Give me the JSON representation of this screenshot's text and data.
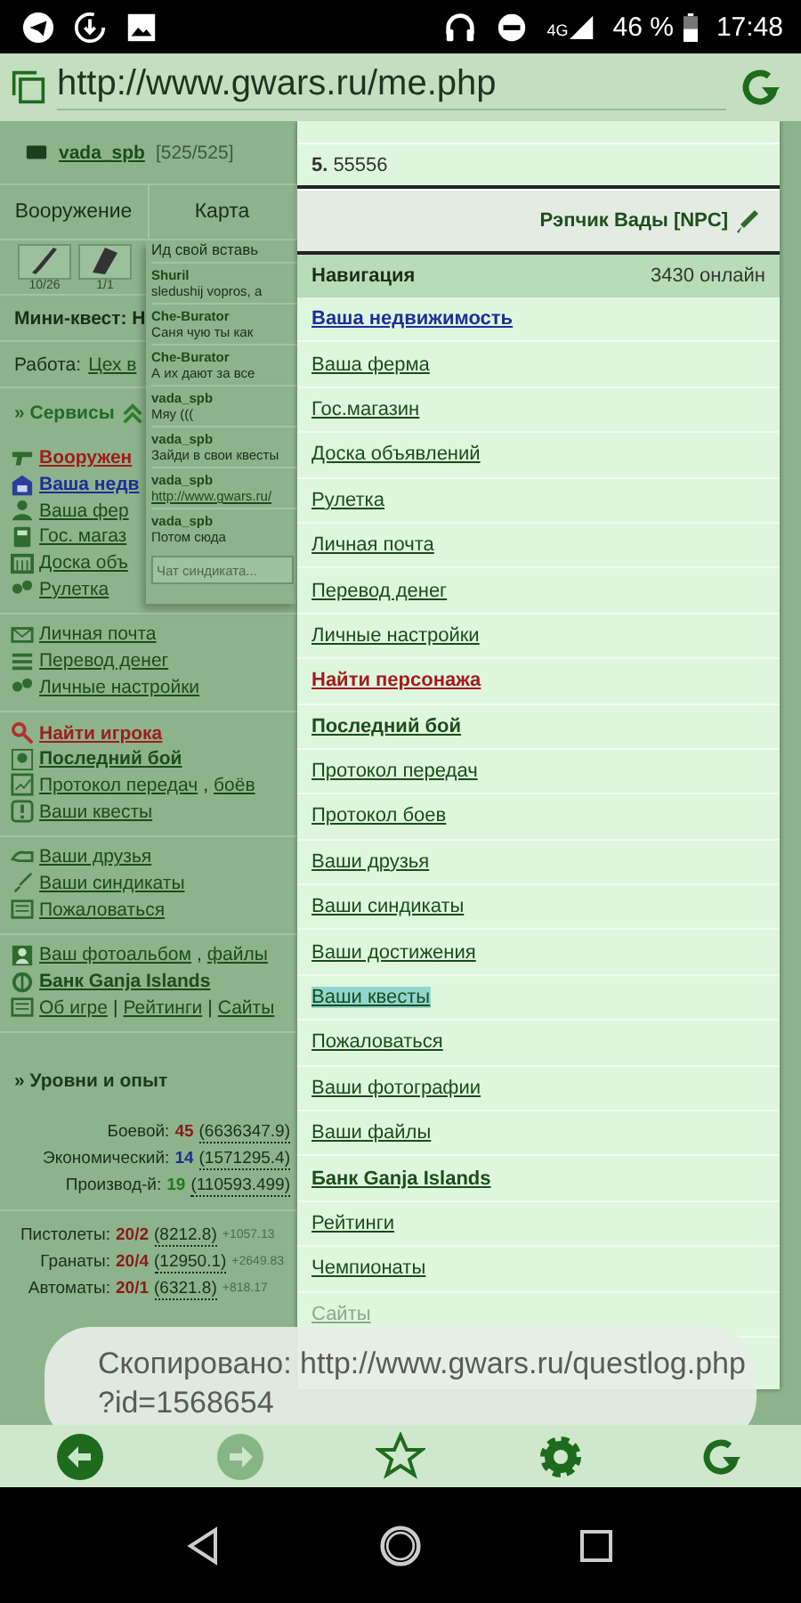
{
  "status_bar": {
    "network": "4G",
    "battery": "46 %",
    "time": "17:48"
  },
  "address_bar": {
    "url": "http://www.gwars.ru/me.php"
  },
  "player": {
    "name": "vada_spb",
    "hp": "[525/525]"
  },
  "tabs": [
    "Вооружение",
    "Карта"
  ],
  "slots": [
    {
      "count": "10/26"
    },
    {
      "count": "1/1"
    }
  ],
  "mini_quest": "Мини-квест: Н",
  "work": {
    "label": "Работа:",
    "link": "Цех в"
  },
  "services": {
    "title": "» Сервисы",
    "items": [
      {
        "links": [
          "Вооружен"
        ],
        "kind": "red"
      },
      {
        "links": [
          "Ваша недв"
        ],
        "kind": "blue"
      },
      {
        "links": [
          "Ваша фер"
        ],
        "kind": "normal"
      },
      {
        "links": [
          "Гос. магаз"
        ],
        "kind": "normal"
      },
      {
        "links": [
          "Доска объ"
        ],
        "kind": "normal"
      },
      {
        "links": [
          "Рулетка"
        ],
        "kind": "normal"
      }
    ]
  },
  "menu_groups": [
    [
      {
        "links": [
          "Личная почта"
        ],
        "kind": "normal"
      },
      {
        "links": [
          "Перевод денег"
        ],
        "kind": "normal"
      },
      {
        "links": [
          "Личные настройки"
        ],
        "kind": "normal"
      }
    ],
    [
      {
        "links": [
          "Найти игрока"
        ],
        "kind": "red"
      },
      {
        "links": [
          "Последний бой"
        ],
        "kind": "bold"
      },
      {
        "links": [
          "Протокол передач",
          "боёв"
        ],
        "separator": ",",
        "kind": "normal"
      },
      {
        "links": [
          "Ваши квесты"
        ],
        "kind": "normal"
      }
    ],
    [
      {
        "links": [
          "Ваши друзья"
        ],
        "kind": "normal"
      },
      {
        "links": [
          "Ваши синдикаты"
        ],
        "kind": "normal"
      },
      {
        "links": [
          "Пожаловаться"
        ],
        "kind": "normal"
      }
    ],
    [
      {
        "links": [
          "Ваш фотоальбом",
          "файлы"
        ],
        "separator": ",",
        "kind": "normal"
      },
      {
        "links": [
          "Банк Ganja Islands"
        ],
        "kind": "bold"
      },
      {
        "links": [
          "Об игре",
          "Рейтинги",
          "Сайты"
        ],
        "separator": "|",
        "kind": "normal"
      }
    ]
  ],
  "levels_title": "» Уровни и опыт",
  "levels": [
    {
      "label": "Боевой:",
      "value": "45",
      "exp": "(6636347.9)",
      "color": "#8b1a1a"
    },
    {
      "label": "Экономический:",
      "value": "14",
      "exp": "(1571295.4)",
      "color": "#1a2f8b"
    },
    {
      "label": "Производ-й:",
      "value": "19",
      "exp": "(110593.499)",
      "color": "#1f7a1f"
    }
  ],
  "skills": [
    {
      "label": "Пистолеты:",
      "value": "20/2",
      "exp": "(8212.8)",
      "gain": "+1057.13"
    },
    {
      "label": "Гранаты:",
      "value": "20/4",
      "exp": "(12950.1)",
      "gain": "+2649.83"
    },
    {
      "label": "Автоматы:",
      "value": "20/1",
      "exp": "(6321.8)",
      "gain": "+818.17"
    }
  ],
  "chat": {
    "top_text": "Ид свой вставь",
    "messages": [
      {
        "author": "Shuril",
        "text": "sledushij vopros, a",
        "kind": "text"
      },
      {
        "author": "Che-Burator",
        "text": "Саня чую ты как",
        "kind": "text"
      },
      {
        "author": "Che-Burator",
        "text": "А их дают за все",
        "kind": "text"
      },
      {
        "author": "vada_spb",
        "text": "Мяу (((",
        "kind": "text"
      },
      {
        "author": "vada_spb",
        "text": "Зайди в свои квесты",
        "kind": "text"
      },
      {
        "author": "vada_spb",
        "text": "http://www.gwars.ru/",
        "kind": "link"
      },
      {
        "author": "vada_spb",
        "text": "Потом сюда",
        "kind": "text"
      }
    ],
    "placeholder": "Чат синдиката..."
  },
  "nav_panel": {
    "rank": {
      "number": "5.",
      "name": "55556"
    },
    "npc": "Рэпчик Вады [NPC]",
    "title": "Навигация",
    "online": "3430 онлайн",
    "items": [
      {
        "label": "Ваша недвижимость",
        "kind": "blue",
        "selected": false
      },
      {
        "label": "Ваша ферма",
        "kind": "normal",
        "selected": false
      },
      {
        "label": "Гос.магазин",
        "kind": "normal",
        "selected": false
      },
      {
        "label": "Доска объявлений",
        "kind": "normal",
        "selected": false
      },
      {
        "label": "Рулетка",
        "kind": "normal",
        "selected": false
      },
      {
        "label": "Личная почта",
        "kind": "normal",
        "selected": false
      },
      {
        "label": "Перевод денег",
        "kind": "normal",
        "selected": false
      },
      {
        "label": "Личные настройки",
        "kind": "normal",
        "selected": false
      },
      {
        "label": "Найти персонажа",
        "kind": "red",
        "selected": false
      },
      {
        "label": "Последний бой",
        "kind": "bold",
        "selected": false
      },
      {
        "label": "Протокол передач",
        "kind": "normal",
        "selected": false
      },
      {
        "label": "Протокол боев",
        "kind": "normal",
        "selected": false
      },
      {
        "label": "Ваши друзья",
        "kind": "normal",
        "selected": false
      },
      {
        "label": "Ваши синдикаты",
        "kind": "normal",
        "selected": false
      },
      {
        "label": "Ваши достижения",
        "kind": "normal",
        "selected": false
      },
      {
        "label": "Ваши квесты",
        "kind": "normal",
        "selected": true
      },
      {
        "label": "Пожаловаться",
        "kind": "normal",
        "selected": false
      },
      {
        "label": "Ваши фотографии",
        "kind": "normal",
        "selected": false
      },
      {
        "label": "Ваши файлы",
        "kind": "normal",
        "selected": false
      },
      {
        "label": "Банк Ganja Islands",
        "kind": "bold",
        "selected": false
      },
      {
        "label": "Рейтинги",
        "kind": "normal",
        "selected": false
      },
      {
        "label": "Чемпионаты",
        "kind": "normal",
        "selected": false
      },
      {
        "label": "Сайты",
        "kind": "faded",
        "selected": false
      }
    ]
  },
  "toast": {
    "lines": [
      "Скопировано: http://www.gwars.ru/questlog.php",
      "?id=1568654"
    ]
  },
  "toolbar": [
    {
      "kind": "back",
      "disabled": false
    },
    {
      "kind": "forward",
      "disabled": true
    },
    {
      "kind": "star",
      "disabled": false
    },
    {
      "kind": "settings",
      "disabled": false
    },
    {
      "kind": "reload",
      "disabled": false
    }
  ]
}
